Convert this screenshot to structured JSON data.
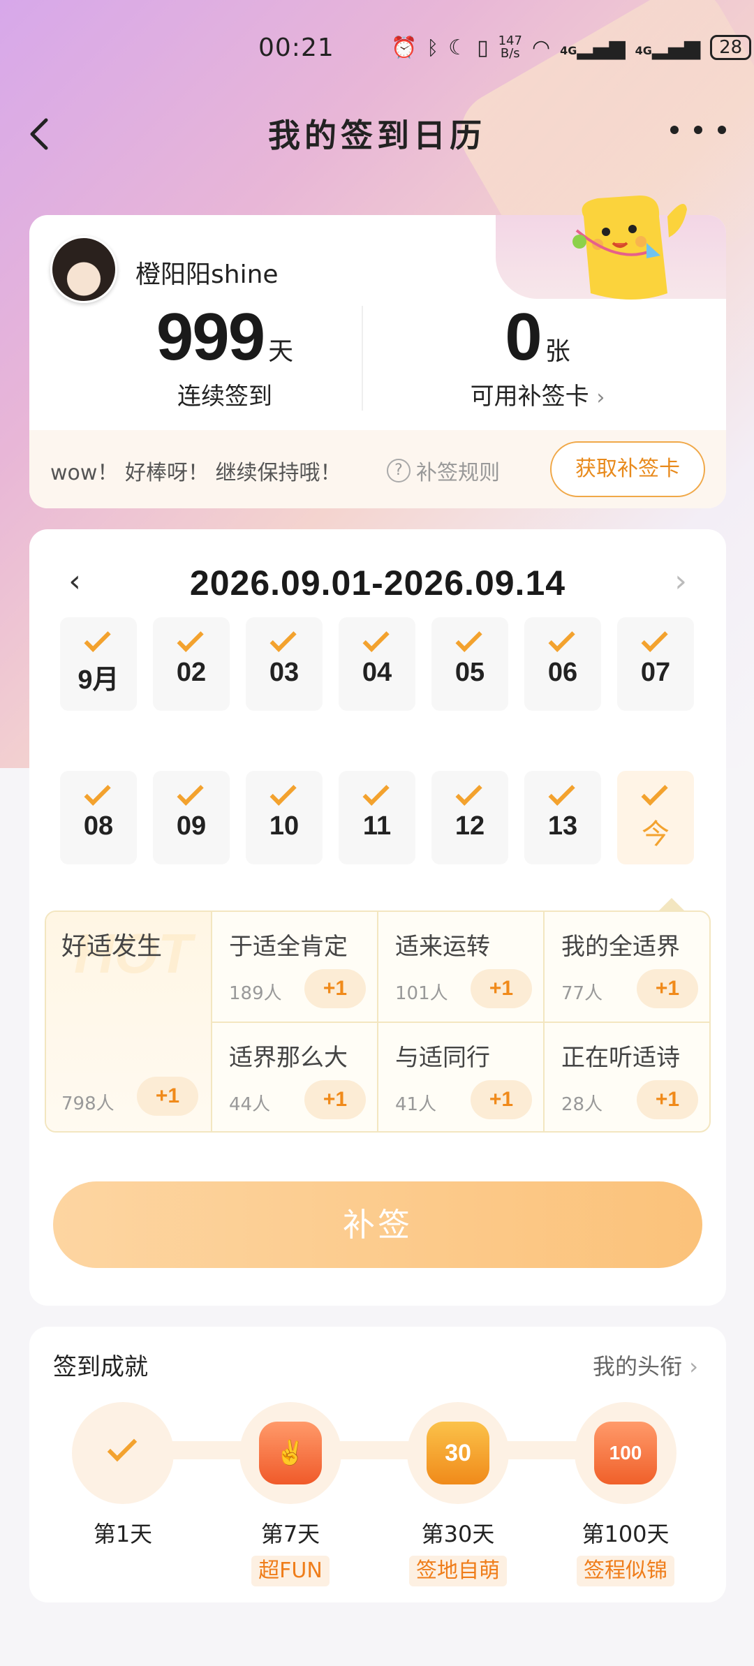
{
  "status": {
    "time": "00:21",
    "speed_top": "147",
    "speed_bottom": "B/s",
    "sig1": "4G",
    "sig2": "4G",
    "battery": "28"
  },
  "nav": {
    "title": "我的签到日历"
  },
  "profile": {
    "username": "橙阳阳shine",
    "streak_value": "999",
    "streak_unit": "天",
    "streak_label": "连续签到",
    "cards_value": "0",
    "cards_unit": "张",
    "cards_label": "可用补签卡",
    "tip": "wow！ 好棒呀！ 继续保持哦！",
    "rule_label": "补签规则",
    "get_card_button": "获取补签卡"
  },
  "calendar": {
    "range": "2026.09.01-2026.09.14",
    "days": [
      "9月",
      "02",
      "03",
      "04",
      "05",
      "06",
      "07",
      "08",
      "09",
      "10",
      "11",
      "12",
      "13",
      "今"
    ],
    "checked": [
      true,
      true,
      true,
      true,
      true,
      true,
      true,
      true,
      true,
      true,
      true,
      true,
      true,
      true
    ]
  },
  "hot_topics": {
    "watermark": "HOT",
    "featured": {
      "title": "好适发生",
      "count": "798人",
      "plus": "+1"
    },
    "items": [
      {
        "title": "于适全肯定",
        "count": "189人",
        "plus": "+1"
      },
      {
        "title": "适来运转",
        "count": "101人",
        "plus": "+1"
      },
      {
        "title": "我的全适界",
        "count": "77人",
        "plus": "+1"
      },
      {
        "title": "适界那么大",
        "count": "44人",
        "plus": "+1"
      },
      {
        "title": "与适同行",
        "count": "41人",
        "plus": "+1"
      },
      {
        "title": "正在听适诗",
        "count": "28人",
        "plus": "+1"
      }
    ]
  },
  "supplement_button": "补签",
  "achievements": {
    "title": "签到成就",
    "link": "我的头衔",
    "items": [
      {
        "label": "第1天",
        "tag": ""
      },
      {
        "label": "第7天",
        "tag": "超FUN"
      },
      {
        "label": "第30天",
        "tag": "签地自萌"
      },
      {
        "label": "第100天",
        "tag": "签程似锦"
      }
    ],
    "badge_texts": [
      "30",
      "100"
    ]
  },
  "colors": {
    "accent": "#f3a22e",
    "plus_text": "#f08a1a",
    "button": "#fbc27a"
  }
}
